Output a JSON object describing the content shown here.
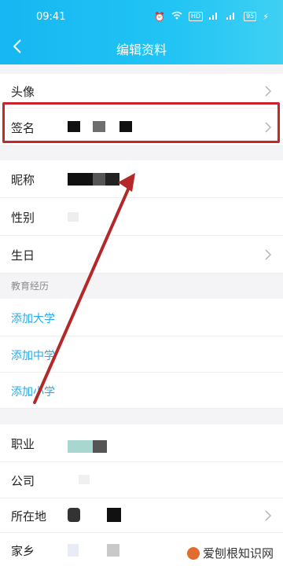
{
  "statusbar": {
    "time": "09:41",
    "battery": "95"
  },
  "header": {
    "title": "编辑资料"
  },
  "rows": {
    "avatar": "头像",
    "signature": "签名",
    "nickname": "昵称",
    "gender": "性别",
    "birthday": "生日",
    "job": "职业",
    "company": "公司",
    "location": "所在地",
    "hometown": "家乡"
  },
  "education": {
    "section_label": "教育经历",
    "add_university": "添加大学",
    "add_middle_school": "添加中学",
    "add_primary_school": "添加小学"
  },
  "watermark": {
    "text": "爱刨根知识网"
  },
  "colors": {
    "header": "#16b7f2",
    "link": "#2aa9e8",
    "highlight": "#c8242a"
  }
}
